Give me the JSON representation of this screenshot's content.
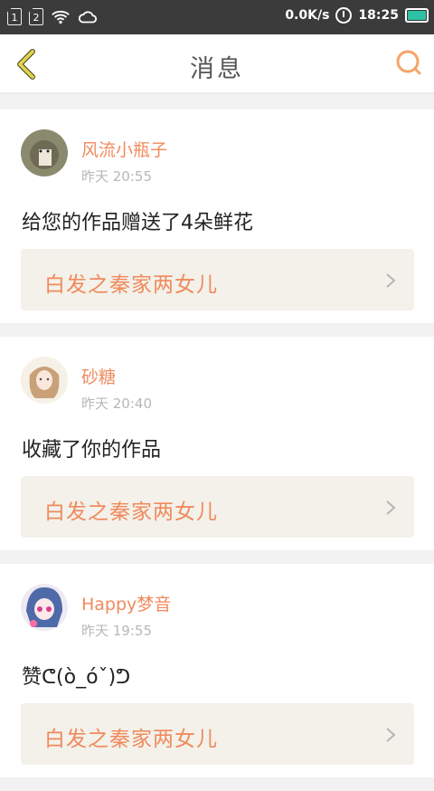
{
  "status_bar": {
    "sim1": "1",
    "sim2": "2",
    "speed": "0.0K/s",
    "time": "18:25",
    "battery_color": "#2ec1a3"
  },
  "nav": {
    "title": "消息",
    "back_icon": "chevron-left-icon",
    "search_icon": "search-icon",
    "accent": "#e6d44f",
    "search_color": "#f6a46a"
  },
  "messages": [
    {
      "name": "风流小瓶子",
      "time": "昨天 20:55",
      "text": "给您的作品赠送了4朵鲜花",
      "work": "白发之秦家两女儿"
    },
    {
      "name": "砂糖",
      "time": "昨天 20:40",
      "text": "收藏了你的作品",
      "work": "白发之秦家两女儿"
    },
    {
      "name": "Happy梦音",
      "time": "昨天 19:55",
      "text": "赞ᕦ(ò_óˇ)ᕤ",
      "work": "白发之秦家两女儿"
    }
  ],
  "colors": {
    "name": "#f08a5d",
    "work_bg": "#f3f1ea"
  }
}
